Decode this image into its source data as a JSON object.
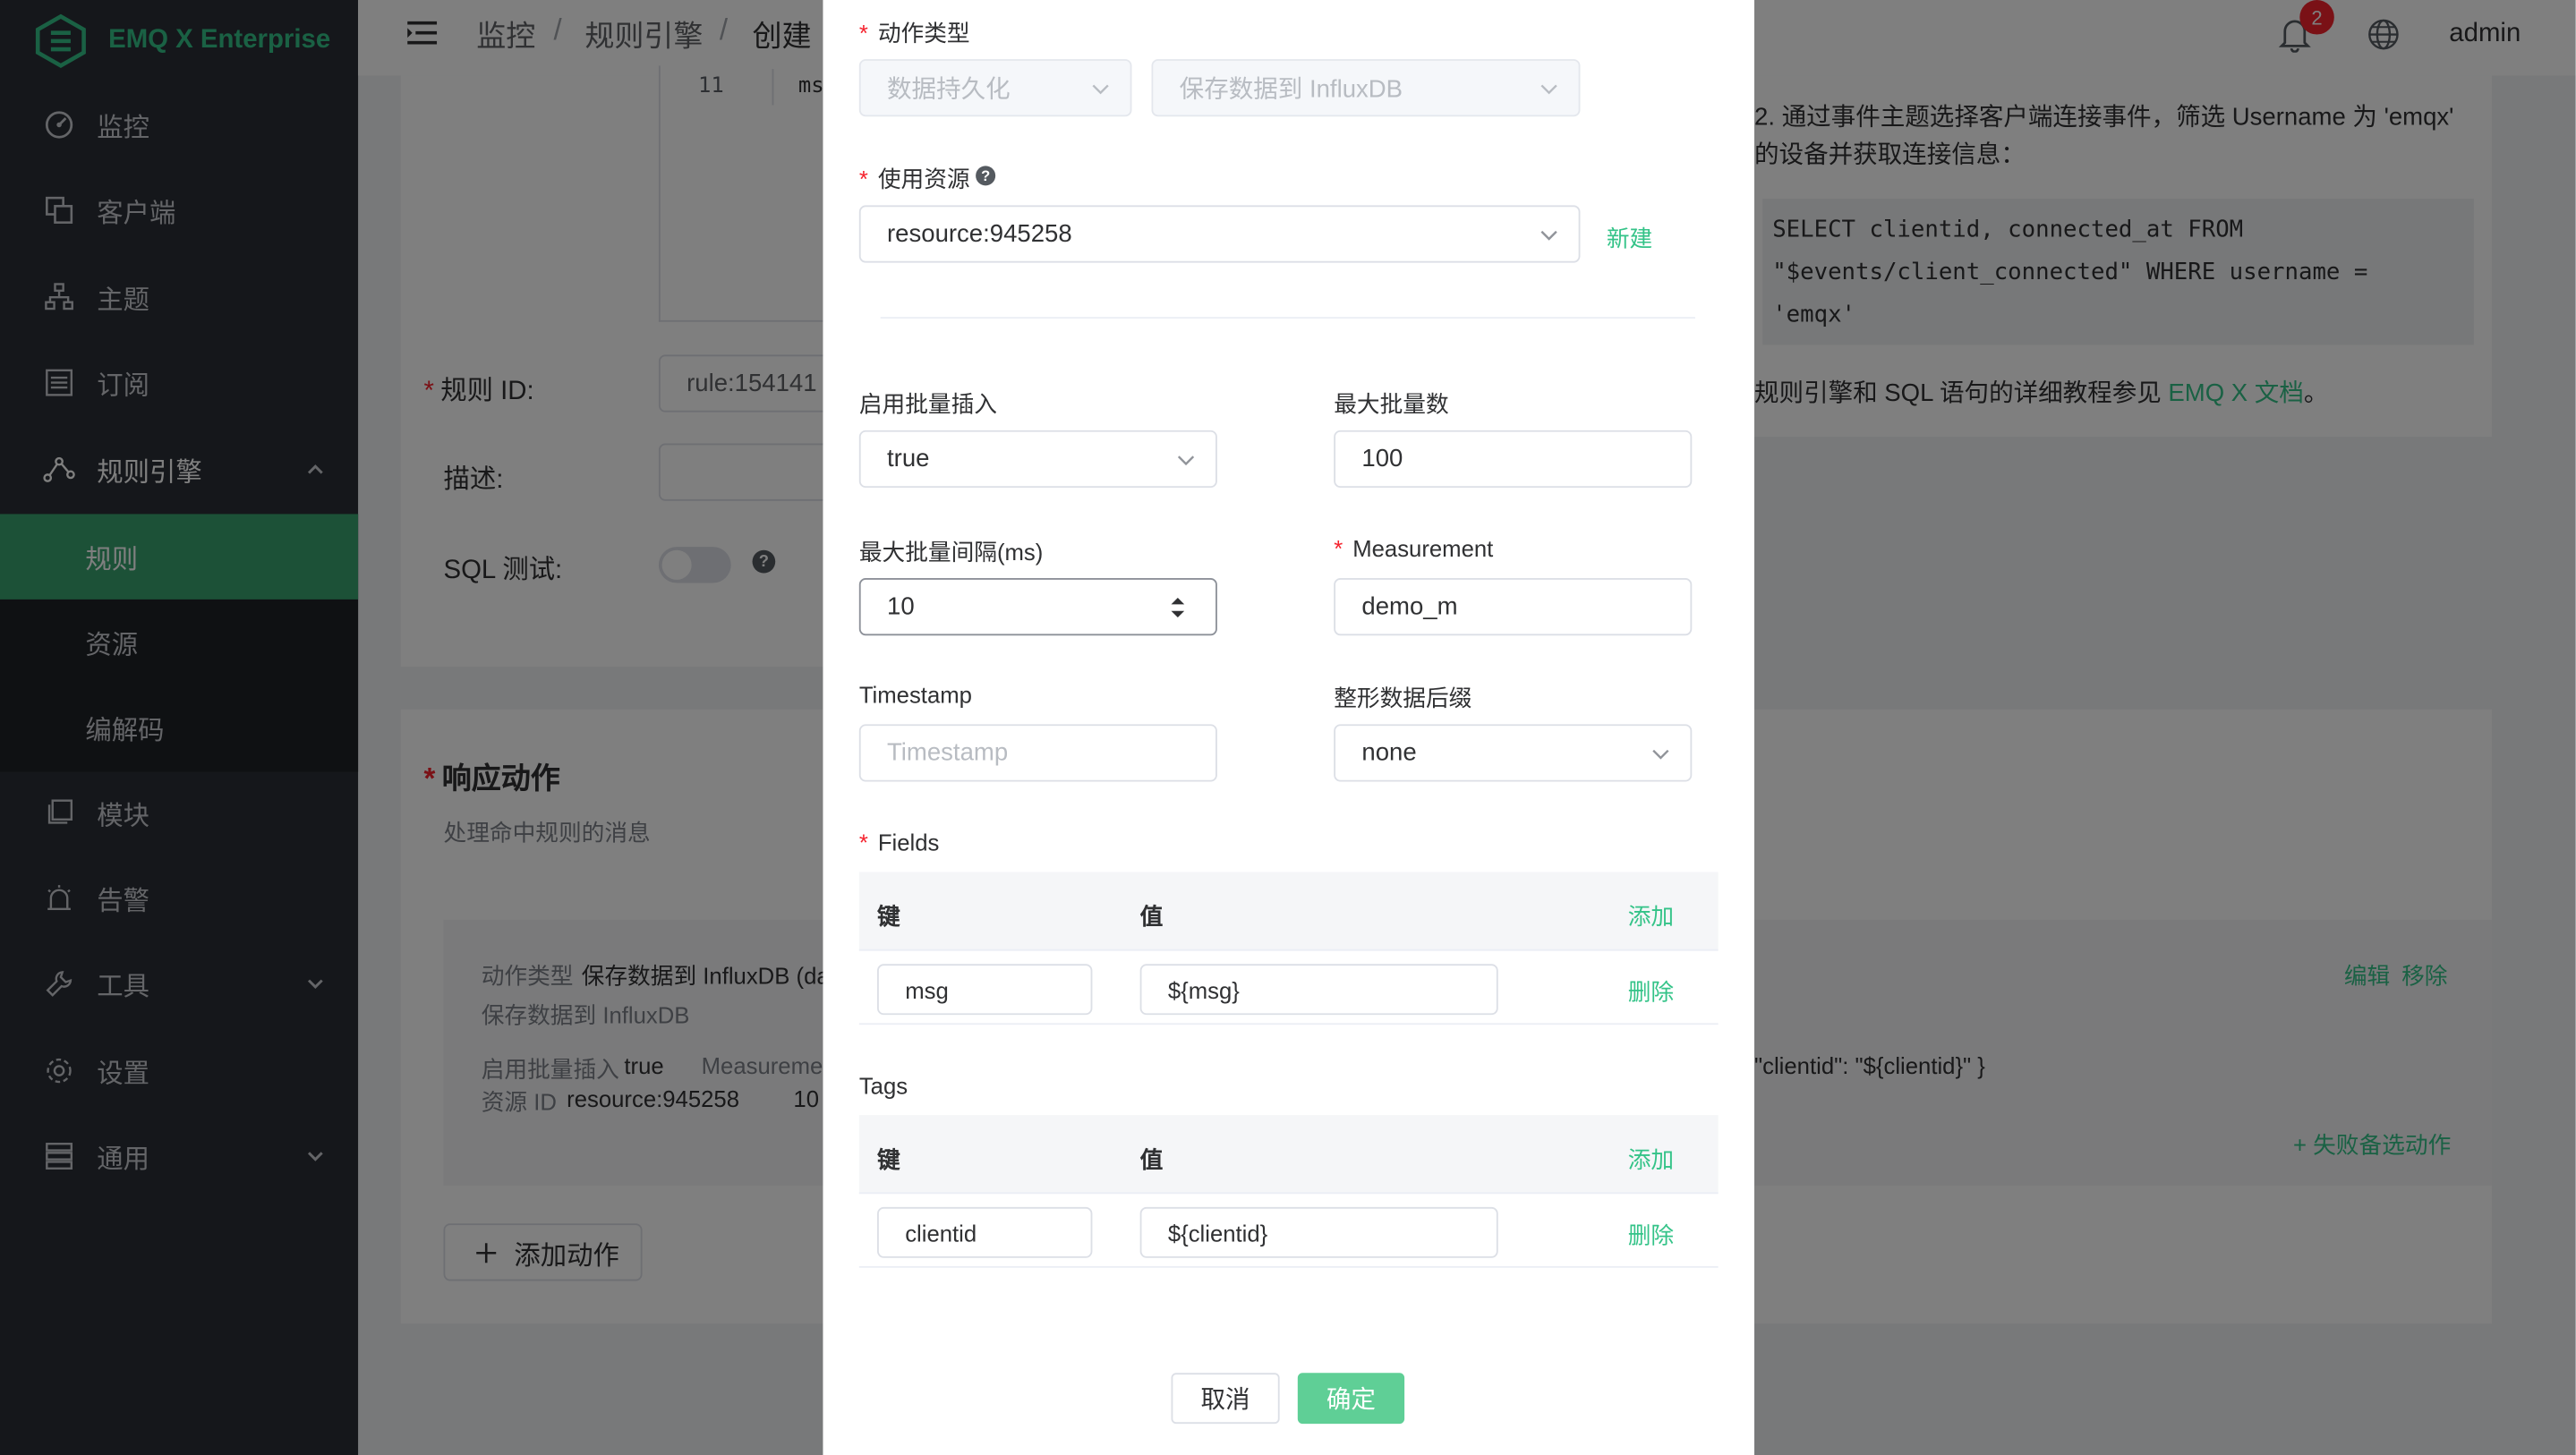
{
  "app": {
    "name": "EMQ X Enterprise",
    "brand_color": "#34c388"
  },
  "sidebar": {
    "items": [
      {
        "label": "监控",
        "icon": "dashboard-icon"
      },
      {
        "label": "客户端",
        "icon": "clients-icon"
      },
      {
        "label": "主题",
        "icon": "topics-icon"
      },
      {
        "label": "订阅",
        "icon": "subscriptions-icon"
      },
      {
        "label": "规则引擎",
        "icon": "rule-engine-icon"
      },
      {
        "label": "模块",
        "icon": "modules-icon"
      },
      {
        "label": "告警",
        "icon": "alarm-icon"
      },
      {
        "label": "工具",
        "icon": "tools-icon"
      },
      {
        "label": "设置",
        "icon": "settings-icon"
      },
      {
        "label": "通用",
        "icon": "general-icon"
      }
    ],
    "rule_engine_sub": [
      {
        "label": "规则",
        "active": true
      },
      {
        "label": "资源",
        "active": false
      },
      {
        "label": "编解码",
        "active": false
      }
    ]
  },
  "header": {
    "breadcrumb": [
      "监控",
      "规则引擎",
      "创建"
    ],
    "breadcrumb_sep": "/",
    "notification_count": "2",
    "user": "admin"
  },
  "rule_form": {
    "code_line_number": "11",
    "code_line_text": "ms",
    "rule_id_label": "规则 ID:",
    "rule_id_value": "rule:154141",
    "desc_label": "描述:",
    "sql_test_label": "SQL 测试:",
    "help_q": "?"
  },
  "actions_section": {
    "title": "响应动作",
    "subtitle": "处理命中规则的消息",
    "action": {
      "type_label": "动作类型",
      "type_value": "保存数据到 InfluxDB (dat",
      "type_desc": "保存数据到 InfluxDB",
      "batch_label": "启用批量插入",
      "batch_value": "true",
      "measurement_label": "Measuremen",
      "resource_label": "资源 ID",
      "resource_value": "resource:945258",
      "resource_extra": "10",
      "tags_tail": "\"clientid\": \"${clientid}\" }",
      "edit": "编辑",
      "remove": "移除",
      "fallback": "+ 失败备选动作"
    },
    "add_action": "添加动作"
  },
  "help_panel": {
    "line1": "2. 通过事件主题选择客户端连接事件，筛选 Username 为 'emqx'",
    "line2": "的设备并获取连接信息：",
    "code1": "SELECT clientid, connected_at FROM",
    "code2": "\"$events/client_connected\" WHERE username =",
    "code3": "'emqx'",
    "doc_prefix": "规则引擎和 SQL 语句的详细教程参见",
    "doc_link": "EMQ X 文档",
    "doc_suffix": "。"
  },
  "dialog": {
    "action_type_label": "动作类型",
    "action_type_category": "数据持久化",
    "action_type_value": "保存数据到 InfluxDB",
    "resource_label": "使用资源",
    "resource_value": "resource:945258",
    "resource_new": "新建",
    "batch_insert_label": "启用批量插入",
    "batch_insert_value": "true",
    "max_batch_label": "最大批量数",
    "max_batch_value": "100",
    "max_interval_label": "最大批量间隔(ms)",
    "max_interval_value": "10",
    "measurement_label": "Measurement",
    "measurement_value": "demo_m",
    "timestamp_label": "Timestamp",
    "timestamp_placeholder": "Timestamp",
    "int_suffix_label": "整形数据后缀",
    "int_suffix_value": "none",
    "fields_label": "Fields",
    "tags_label": "Tags",
    "col_key": "键",
    "col_value": "值",
    "add": "添加",
    "delete": "删除",
    "fields": [
      {
        "key": "msg",
        "value": "${msg}"
      }
    ],
    "tags": [
      {
        "key": "clientid",
        "value": "${clientid}"
      }
    ],
    "cancel": "取消",
    "confirm": "确定"
  }
}
